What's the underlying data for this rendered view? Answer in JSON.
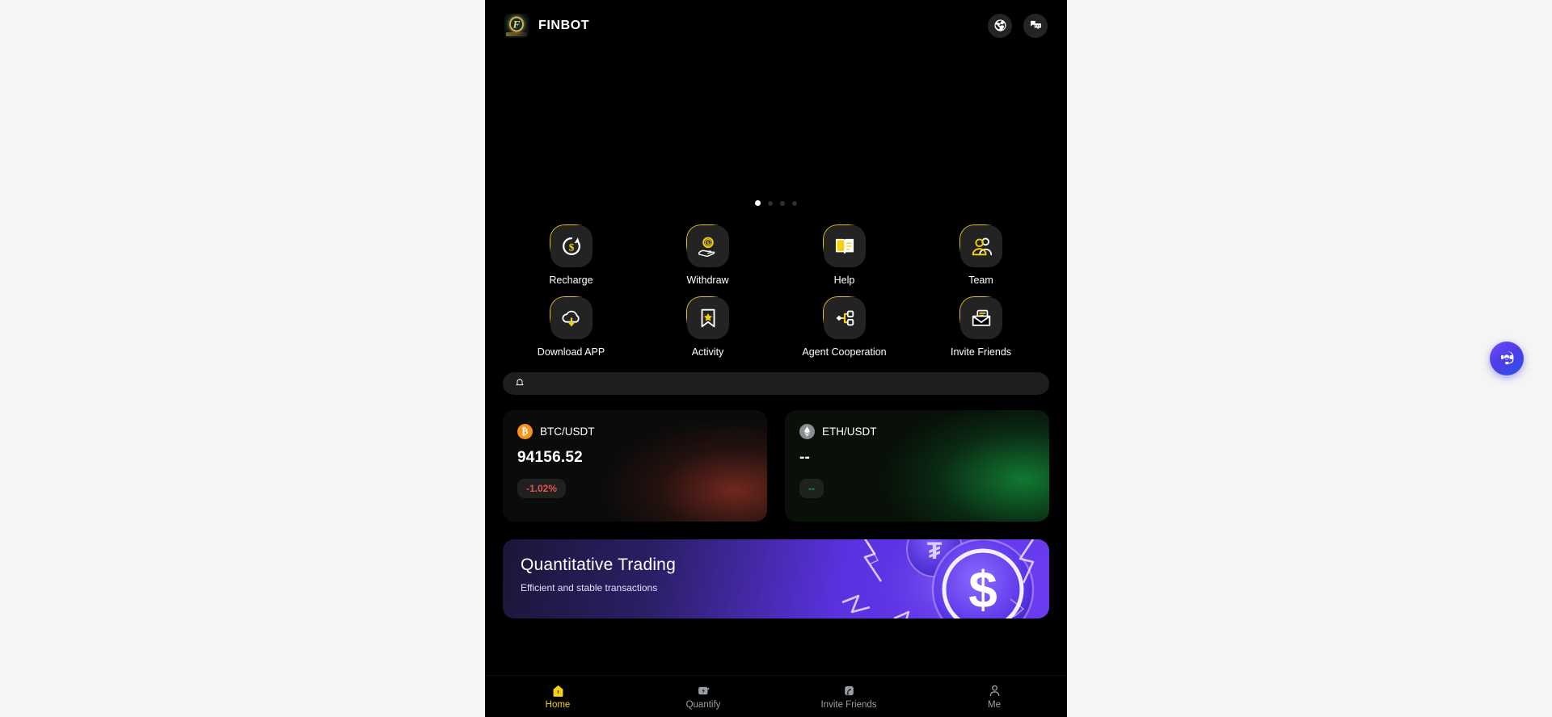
{
  "app": {
    "brand": "FINBOT",
    "logo_icon": "finbot-logo-icon"
  },
  "header": {
    "language_icon": "globe-icon",
    "support_chat_icon": "chat-bubbles-icon"
  },
  "carousel": {
    "slide_count": 4,
    "active_index": 0
  },
  "quick_actions": [
    {
      "label": "Recharge",
      "icon": "dollar-refresh-icon"
    },
    {
      "label": "Withdraw",
      "icon": "hand-coin-icon"
    },
    {
      "label": "Help",
      "icon": "open-book-icon"
    },
    {
      "label": "Team",
      "icon": "people-icon"
    },
    {
      "label": "Download APP",
      "icon": "cloud-download-icon"
    },
    {
      "label": "Activity",
      "icon": "bookmark-star-icon"
    },
    {
      "label": "Agent Cooperation",
      "icon": "node-network-icon"
    },
    {
      "label": "Invite Friends",
      "icon": "envelope-card-icon"
    }
  ],
  "notice": {
    "icon": "bell-icon",
    "text": ""
  },
  "markets": [
    {
      "pair": "BTC/USDT",
      "coin_icon": "bitcoin-icon",
      "price": "94156.52",
      "change": "-1.02%",
      "direction": "down",
      "accent": "#e0564a"
    },
    {
      "pair": "ETH/USDT",
      "coin_icon": "ethereum-icon",
      "price": "--",
      "change": "--",
      "direction": "flat",
      "accent": "#16a34a"
    }
  ],
  "promo": {
    "title": "Quantitative Trading",
    "subtitle": "Efficient and stable transactions",
    "art_icon": "dollar-coin-lightning-art"
  },
  "bottom_nav": {
    "active": "Home",
    "items": [
      {
        "label": "Home",
        "icon": "home-icon"
      },
      {
        "label": "Quantify",
        "icon": "lightning-card-icon"
      },
      {
        "label": "Invite Friends",
        "icon": "share-hand-icon"
      },
      {
        "label": "Me",
        "icon": "person-icon"
      }
    ]
  },
  "floating": {
    "support_icon": "headset-agent-icon"
  }
}
